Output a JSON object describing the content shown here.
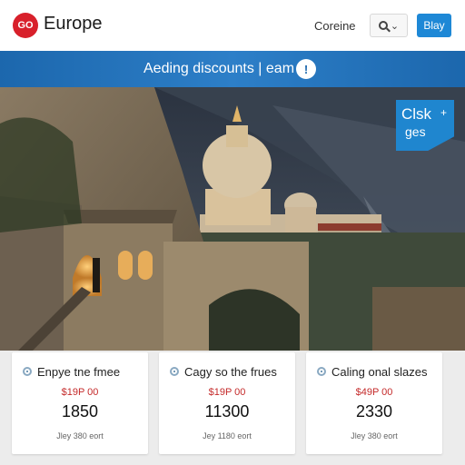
{
  "header": {
    "logo_text": "GO",
    "brand": "Europe",
    "nav_link": "Coreine",
    "cta_label": "Blay"
  },
  "banner": {
    "text": "Aeding discounts | eam"
  },
  "badge": {
    "line1": "Clsk",
    "line2": "ges"
  },
  "cards": [
    {
      "title": "Enpye tne fmee",
      "price_old": "$19P 00",
      "price": "1850",
      "note": "Jley 380 eort"
    },
    {
      "title": "Cagy so the frues",
      "price_old": "$19P 00",
      "price": "11300",
      "note": "Jey 1180 eort"
    },
    {
      "title": "Caling onal slazes",
      "price_old": "$49P 00",
      "price": "2330",
      "note": "Jley 380 eort"
    }
  ],
  "colors": {
    "brand_red": "#d8202b",
    "banner_blue": "#1c67ad",
    "cta_blue": "#1e88d6",
    "price_red": "#c42a2a"
  },
  "icons": {
    "logo": "go-logo",
    "search": "search-icon",
    "chevron": "chevron-down-icon",
    "banner": "info-icon",
    "card": "location-pin-icon"
  }
}
